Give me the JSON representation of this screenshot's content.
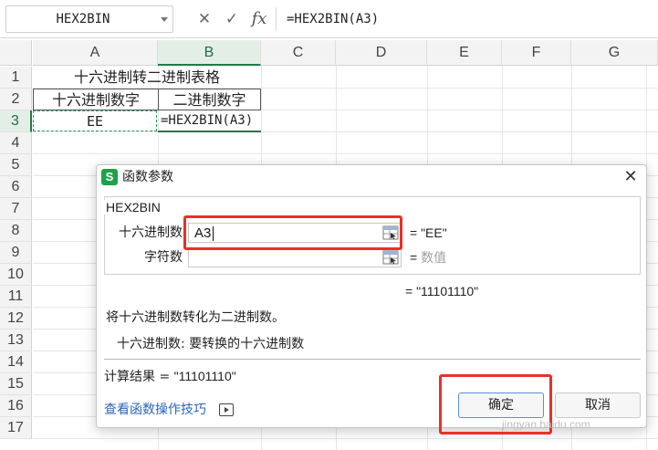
{
  "formula_bar": {
    "name_box": "HEX2BIN",
    "cancel_icon": "✕",
    "confirm_icon": "✓",
    "fx_label": "fx",
    "formula": "=HEX2BIN(A3)"
  },
  "columns": [
    "A",
    "B",
    "C",
    "D",
    "E",
    "F",
    "G"
  ],
  "rows": [
    "1",
    "2",
    "3",
    "4",
    "5",
    "6",
    "7",
    "8",
    "9",
    "10",
    "11",
    "12",
    "13",
    "14",
    "15",
    "16",
    "17"
  ],
  "sheet": {
    "title": "十六进制转二进制表格",
    "header_a": "十六进制数字",
    "header_b": "二进制数字",
    "a3": "EE",
    "b3": "=HEX2BIN(A3)"
  },
  "dialog": {
    "icon_letter": "S",
    "title": "函数参数",
    "close": "✕",
    "function_name": "HEX2BIN",
    "arg1_label": "十六进制数",
    "arg1_value": "A3",
    "arg1_result": "= \"EE\"",
    "arg2_label": "字符数",
    "arg2_value": "",
    "arg2_result_eq": "=",
    "arg2_result_hint": "数值",
    "function_result": "= \"11101110\"",
    "description": "将十六进制数转化为二进制数。",
    "arg_description": "十六进制数:  要转换的十六进制数",
    "calc_label": "计算结果 =",
    "calc_value": "\"11101110\"",
    "tips_link": "查看函数操作技巧",
    "ok_button": "确定",
    "cancel_button": "取消"
  },
  "watermark": "jingyan.baidu.com",
  "colors": {
    "selection_green": "#1f7a45",
    "highlight_red": "#e8302a",
    "link_blue": "#2a66b8",
    "brand_green": "#1fa14a"
  }
}
